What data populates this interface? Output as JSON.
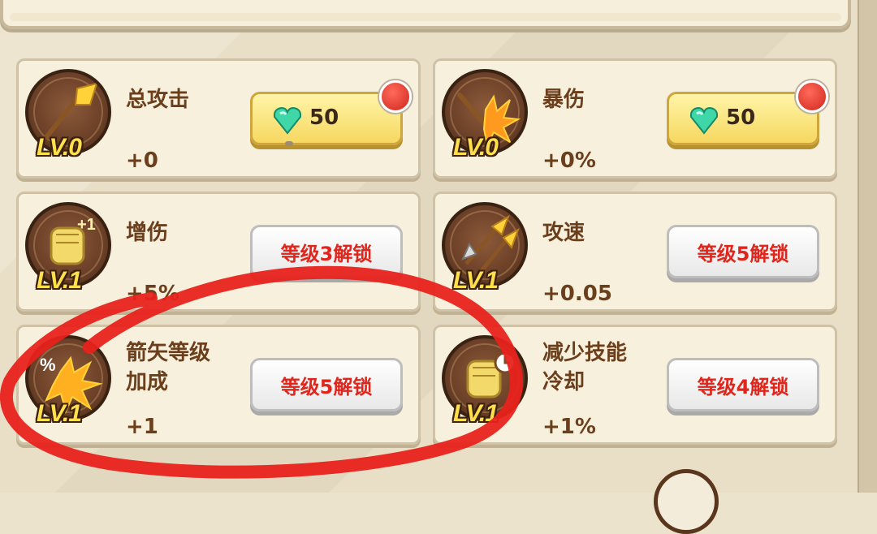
{
  "cards": [
    {
      "name": "总攻击",
      "value": "+0",
      "level": "LV.0",
      "button": {
        "type": "gem",
        "price": "50",
        "has_alert": true
      }
    },
    {
      "name": "暴伤",
      "value": "+0%",
      "level": "LV.0",
      "button": {
        "type": "gem",
        "price": "50",
        "has_alert": true
      }
    },
    {
      "name": "增伤",
      "value": "+5%",
      "level": "LV.1",
      "button": {
        "type": "locked",
        "label": "等级3解锁"
      }
    },
    {
      "name": "攻速",
      "value": "+0.05",
      "level": "LV.1",
      "button": {
        "type": "locked",
        "label": "等级5解锁"
      }
    },
    {
      "name": "箭矢等级\n加成",
      "value": "+1",
      "level": "LV.1",
      "button": {
        "type": "locked",
        "label": "等级5解锁"
      }
    },
    {
      "name": "减少技能\n冷却",
      "value": "+1%",
      "level": "LV.1",
      "button": {
        "type": "locked",
        "label": "等级4解锁"
      }
    }
  ],
  "icons": [
    "spear-icon",
    "critical-hit-icon",
    "fist-plus-icon",
    "arrows-icon",
    "percent-burst-icon",
    "fist-clock-icon"
  ],
  "colors": {
    "locked_text": "#e0261c",
    "level_text": "#ffe04a",
    "label_text": "#6b3f1c",
    "annotation": "#e8221c"
  }
}
